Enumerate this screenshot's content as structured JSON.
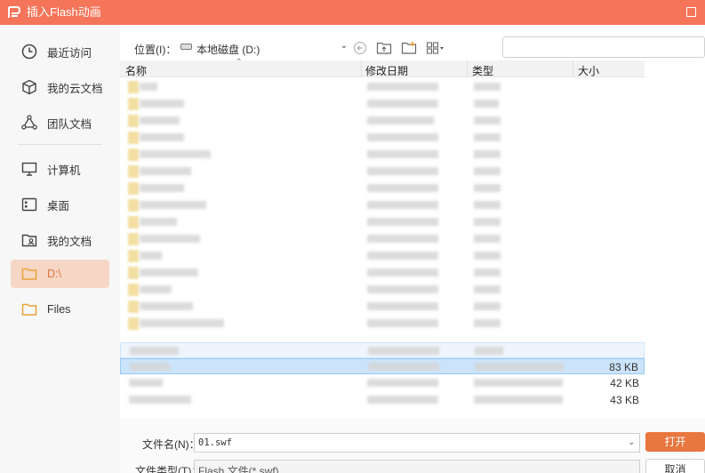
{
  "window": {
    "title": "插入Flash动画"
  },
  "sidebar": {
    "items": [
      {
        "label": "最近访问",
        "icon": "clock-icon"
      },
      {
        "label": "我的云文档",
        "icon": "cube-icon"
      },
      {
        "label": "团队文档",
        "icon": "team-icon"
      },
      {
        "label": "计算机",
        "icon": "monitor-icon"
      },
      {
        "label": "桌面",
        "icon": "desktop-icon"
      },
      {
        "label": "我的文档",
        "icon": "user-folder-icon"
      },
      {
        "label": "D:\\",
        "icon": "folder-icon",
        "active": true
      },
      {
        "label": "Files",
        "icon": "folder-icon"
      }
    ]
  },
  "toolbar": {
    "location_label": "位置(I)：",
    "location_value": "本地磁盘 (D:)",
    "search_placeholder": ""
  },
  "filelist": {
    "columns": {
      "name": "名称",
      "modified": "修改日期",
      "type": "类型",
      "size": "大小"
    },
    "visible_sizes": [
      "83 KB",
      "42 KB",
      "43 KB"
    ]
  },
  "bottom": {
    "filename_label": "文件名(N)：",
    "filename_value": "01.swf",
    "filetype_label": "文件类型(T)：",
    "filetype_value": "Flash 文件(*.swf)",
    "open_label": "打开",
    "cancel_label": "取消"
  },
  "colors": {
    "accent": "#f4755a",
    "open_button": "#e8763f",
    "active_item_bg": "#f6d6c5",
    "selection": "#cce4fb"
  }
}
